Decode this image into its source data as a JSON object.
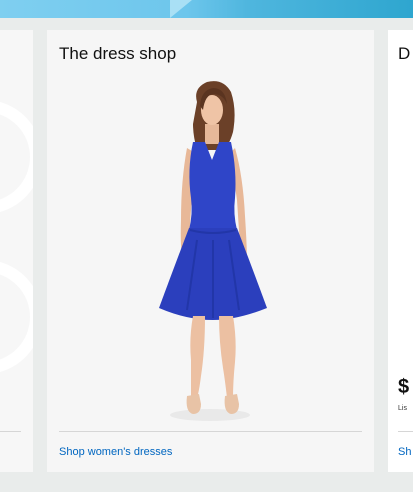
{
  "main_card": {
    "title": "The dress shop",
    "link": "Shop women's dresses",
    "image": "woman-in-blue-dress-image"
  },
  "right_card": {
    "title_partial": "D",
    "price_partial": "$",
    "list_partial": "Lis",
    "link_partial": "Sh"
  },
  "colors": {
    "link": "#0066c0",
    "dress": "#2f45c8",
    "banner": "#4fb6de"
  }
}
